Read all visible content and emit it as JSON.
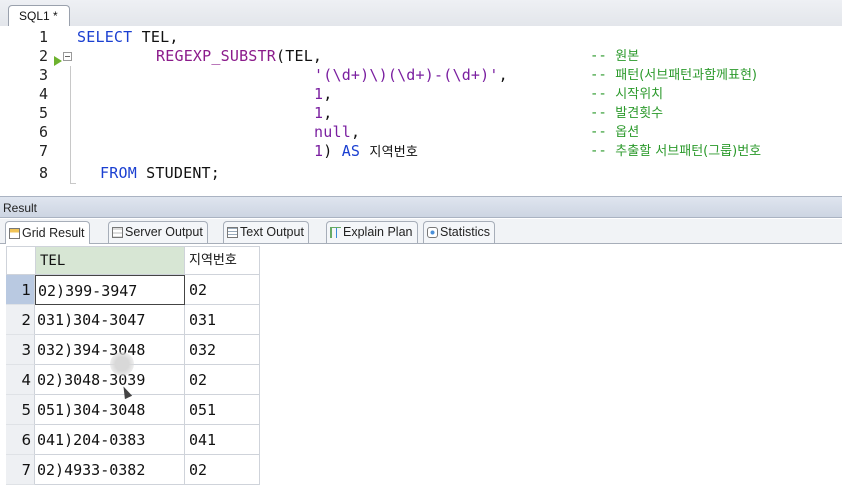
{
  "window": {
    "tab_label": "SQL1 *"
  },
  "editor": {
    "line_numbers": [
      "1",
      "2",
      "3",
      "4",
      "5",
      "6",
      "7",
      "8"
    ],
    "lines": {
      "l1_kw": "SELECT",
      "l1_rest": " TEL,",
      "l2_fn": "REGEXP_SUBSTR",
      "l2_rest": "(TEL,",
      "l3_str": "'(\\d+)\\)(\\d+)-(\\d+)'",
      "l3_rest": ",",
      "l4_num": "1",
      "l4_rest": ",",
      "l5_num": "1",
      "l5_rest": ",",
      "l6_kw": "null",
      "l6_rest": ",",
      "l7_num": "1",
      "l7_rest": ") ",
      "l7_kw": "AS",
      "l7_alias": "지역번호",
      "l8_kw": "FROM",
      "l8_rest": " STUDENT;"
    },
    "comments": {
      "c2_dash": "-- ",
      "c2": "원본",
      "c3_dash": "-- ",
      "c3": "패턴(서브패턴과함께표현)",
      "c4_dash": "-- ",
      "c4": "시작위치",
      "c5_dash": "-- ",
      "c5": "발견횟수",
      "c6_dash": "-- ",
      "c6": "옵션",
      "c7_dash": "-- ",
      "c7": "추출할 서브패턴(그룹)번호"
    }
  },
  "result": {
    "label": "Result",
    "tabs": [
      {
        "label": "Grid Result"
      },
      {
        "label": "Server Output"
      },
      {
        "label": "Text Output"
      },
      {
        "label": "Explain Plan"
      },
      {
        "label": "Statistics"
      }
    ],
    "columns": [
      "TEL",
      "지역번호"
    ],
    "rows": [
      {
        "num": "1",
        "tel": "02)399-3947",
        "area": "02"
      },
      {
        "num": "2",
        "tel": "031)304-3047",
        "area": "031"
      },
      {
        "num": "3",
        "tel": "032)394-3048",
        "area": "032"
      },
      {
        "num": "4",
        "tel": "02)3048-3039",
        "area": "02"
      },
      {
        "num": "5",
        "tel": "051)304-3048",
        "area": "051"
      },
      {
        "num": "6",
        "tel": "041)204-0383",
        "area": "041"
      },
      {
        "num": "7",
        "tel": "02)4933-0382",
        "area": "02"
      }
    ]
  }
}
